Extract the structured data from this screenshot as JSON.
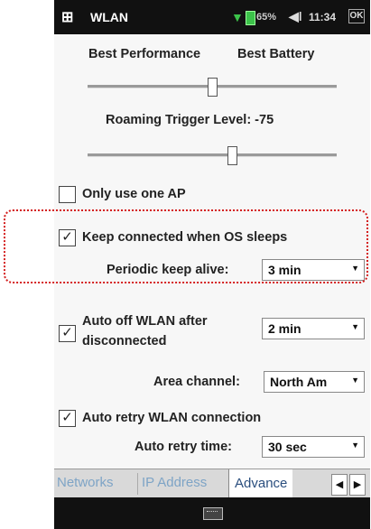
{
  "statusbar": {
    "app_title": "WLAN",
    "battery": "65%",
    "time": "11:34",
    "close_label": "OK"
  },
  "power": {
    "left_label": "Best Performance",
    "right_label": "Best Battery",
    "level": 0.5
  },
  "roaming": {
    "label": "Roaming Trigger Level: -75",
    "level": 0.58
  },
  "options": {
    "only_one_ap": {
      "label": "Only use one AP",
      "checked": false
    },
    "keep_connected": {
      "label": "Keep connected when OS sleeps",
      "checked": true
    },
    "periodic_label": "Periodic keep alive:",
    "periodic_value": "3 min",
    "auto_off_label_line1": "Auto off WLAN after",
    "auto_off_label_line2": "disconnected",
    "auto_off_checked": true,
    "auto_off_value": "2 min",
    "area_label": "Area channel:",
    "area_value": "North Am",
    "auto_retry": {
      "label": "Auto retry WLAN connection",
      "checked": true
    },
    "retry_time_label": "Auto retry time:",
    "retry_time_value": "30 sec"
  },
  "tabs": [
    "Networks",
    "IP Address",
    "Advance"
  ],
  "check_glyph": "✓",
  "highlight_color": "#d41f1f"
}
